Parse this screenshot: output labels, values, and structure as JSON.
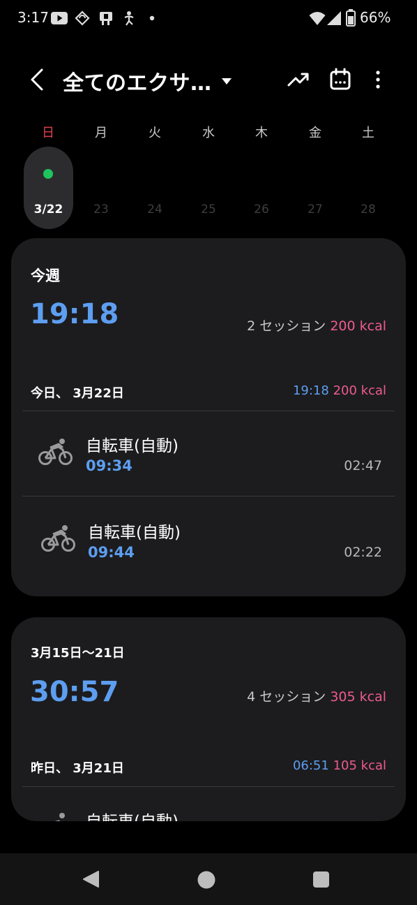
{
  "status": {
    "time": "3:17",
    "battery": "66%",
    "left_icons": [
      "youtube-icon",
      "sync-icon",
      "app-icon",
      "accessibility-icon",
      "dot-icon"
    ],
    "right_icons": [
      "wifi-icon",
      "signal-icon",
      "battery-icon"
    ]
  },
  "app_bar": {
    "title": "全てのエクサ…",
    "icons": [
      "back-icon",
      "dropdown-caret-icon",
      "trend-icon",
      "calendar-icon",
      "more-icon"
    ]
  },
  "week": {
    "days": [
      {
        "label": "日",
        "num": "3/22"
      },
      {
        "label": "月",
        "num": "23"
      },
      {
        "label": "火",
        "num": "24"
      },
      {
        "label": "水",
        "num": "25"
      },
      {
        "label": "木",
        "num": "26"
      },
      {
        "label": "金",
        "num": "27"
      },
      {
        "label": "土",
        "num": "28"
      }
    ],
    "selected_index": 0,
    "colors": {
      "sunday": "#e0424a",
      "activity_dot": "#1ec45e"
    }
  },
  "this_week": {
    "period": "今週",
    "total_time": "19:18",
    "sessions": "2 セッション",
    "kcal": "200 kcal",
    "day_groups": [
      {
        "header": "今日、 3月22日",
        "time": "19:18",
        "kcal": "200 kcal",
        "items": [
          {
            "name": "自転車(自動)",
            "start": "09:34",
            "duration": "02:47",
            "icon": "cycling-icon"
          },
          {
            "name": "自転車(自動)",
            "start": "09:44",
            "duration": "02:22",
            "icon": "cycling-icon"
          }
        ]
      }
    ]
  },
  "prev_week": {
    "period": "3月15日～21日",
    "total_time": "30:57",
    "sessions": "4 セッション",
    "kcal": "305 kcal",
    "day_groups": [
      {
        "header": "昨日、 3月21日",
        "time": "06:51",
        "kcal": "105 kcal",
        "items": [
          {
            "name": "自転車(自動)",
            "icon": "cycling-icon"
          }
        ]
      }
    ]
  },
  "colors": {
    "accent_blue": "#5d9ef0",
    "kcal_pink": "#ee5b8e",
    "card_bg": "#1c1c1e"
  },
  "nav": {
    "icons": [
      "nav-back-icon",
      "nav-home-icon",
      "nav-recents-icon"
    ]
  }
}
